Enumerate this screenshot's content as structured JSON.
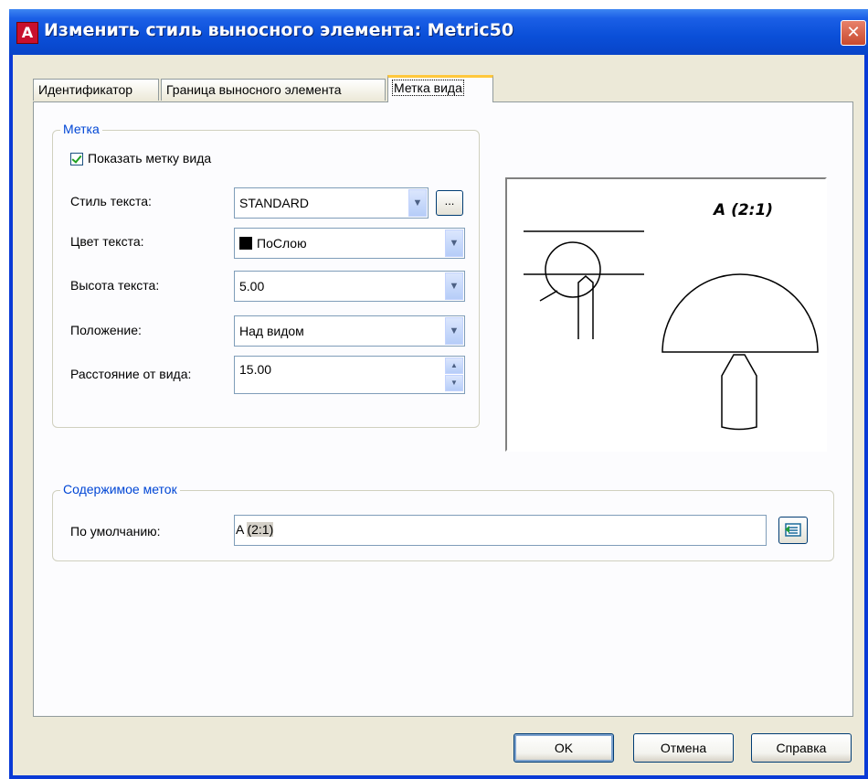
{
  "window": {
    "app_icon": "A",
    "title": "Изменить стиль выносного элемента: Metric50",
    "close_glyph": "✕"
  },
  "tabs": [
    {
      "label": "Идентификатор",
      "active": false
    },
    {
      "label": "Граница выносного элемента",
      "active": false
    },
    {
      "label": "Метка вида",
      "active": true
    }
  ],
  "label_group": {
    "title": "Метка",
    "show_label": {
      "label": "Показать метку вида",
      "checked": true
    },
    "text_style": {
      "label": "Стиль текста:",
      "value": "STANDARD",
      "browse": "..."
    },
    "text_color": {
      "label": "Цвет текста:",
      "value": "ПоСлою",
      "swatch": "#000000"
    },
    "text_height": {
      "label": "Высота текста:",
      "value": "5.00"
    },
    "position": {
      "label": "Положение:",
      "value": "Над видом"
    },
    "distance": {
      "label": "Расстояние от вида:",
      "value": "15.00"
    }
  },
  "preview": {
    "label": "A (2:1)"
  },
  "content_group": {
    "title": "Содержимое меток",
    "default": {
      "label": "По умолчанию:",
      "value": "A (2:1)",
      "value_prefix": "A",
      "value_field": "(2:1)"
    }
  },
  "buttons": {
    "ok": "OK",
    "cancel": "Отмена",
    "help": "Справка"
  },
  "colors": {
    "title_bar": "#0a4fd8",
    "dialog_bg": "#ece9d8",
    "group_title": "#0046d5",
    "active_tab_highlight": "#ffc83c"
  }
}
